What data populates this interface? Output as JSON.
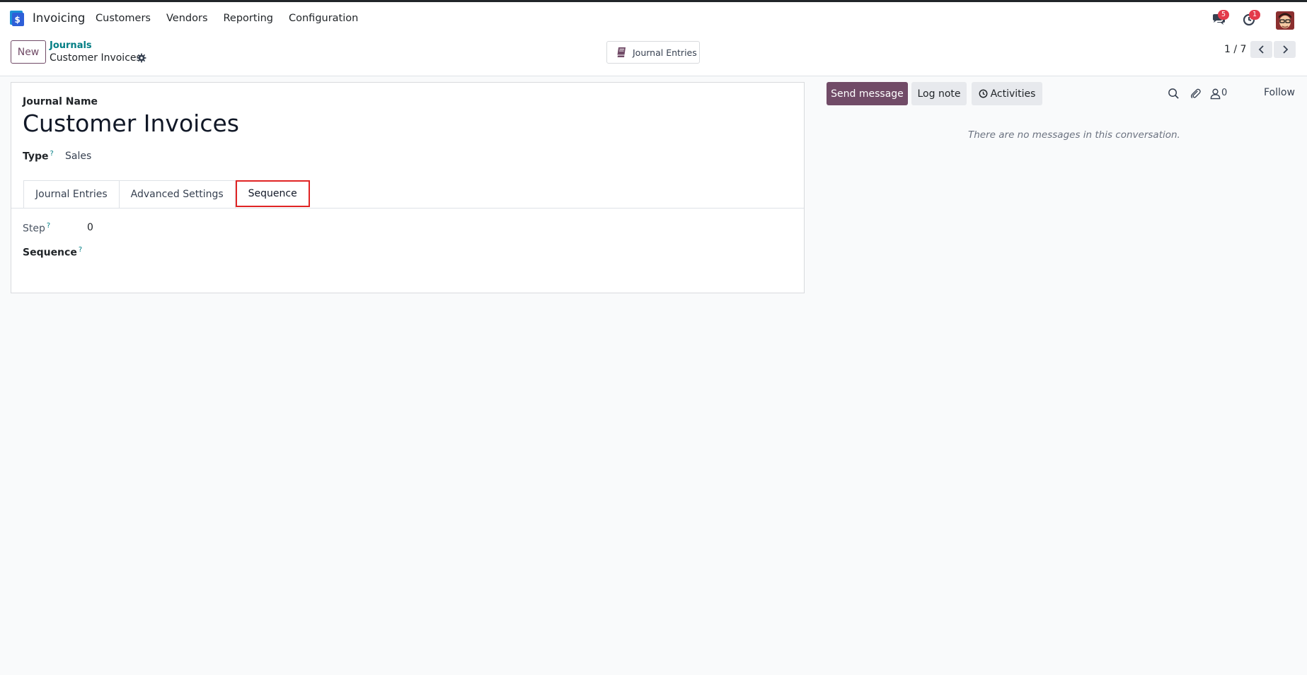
{
  "navbar": {
    "app_name": "Invoicing",
    "menu": [
      "Customers",
      "Vendors",
      "Reporting",
      "Configuration"
    ],
    "messages_badge": "5",
    "activities_badge": "1"
  },
  "control_panel": {
    "new_label": "New",
    "breadcrumb_parent": "Journals",
    "breadcrumb_current": "Customer Invoices",
    "smart_button_label": "Journal Entries",
    "pager": "1 / 7"
  },
  "form": {
    "name_label": "Journal Name",
    "name_value": "Customer Invoices",
    "type_label": "Type",
    "type_value": "Sales",
    "help_mark": "?",
    "tabs": [
      "Journal Entries",
      "Advanced Settings",
      "Sequence"
    ],
    "step_label": "Step",
    "step_value": "0",
    "sequence_label": "Sequence"
  },
  "chatter": {
    "send_message": "Send message",
    "log_note": "Log note",
    "activities": "Activities",
    "followers_count": "0",
    "follow": "Follow",
    "empty_text": "There are no messages in this conversation."
  },
  "colors": {
    "brand": "#714b67",
    "link": "#017e84",
    "badge": "#e33a4b",
    "highlight": "#e02424"
  },
  "icons": [
    "app-logo-icon",
    "chat-bubbles-icon",
    "clock-icon",
    "gear-icon",
    "book-icon",
    "chevron-left-icon",
    "chevron-right-icon",
    "search-icon",
    "paperclip-icon",
    "user-icon"
  ]
}
